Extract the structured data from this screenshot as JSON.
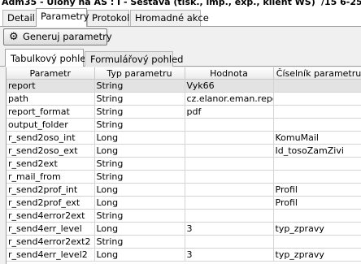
{
  "window": {
    "title": "Adm35 - Úlohy na AS : I - Sestava (tisk., imp., exp., klient WS)",
    "title_right": "/15 6-25"
  },
  "main_tabs": [
    {
      "label": "Detail"
    },
    {
      "label": "Parametry"
    },
    {
      "label": "Protokol"
    },
    {
      "label": "Hromadné akce"
    }
  ],
  "toolbar": {
    "generate_label": "Generuj parametry",
    "generate_icon": "gear-icon"
  },
  "sub_tabs": [
    {
      "label": "Tabulkový pohled"
    },
    {
      "label": "Formulářový pohled"
    }
  ],
  "table": {
    "columns": [
      "Parametr",
      "Typ parametru",
      "Hodnota",
      "Číselník parametru"
    ],
    "rows": [
      [
        "report",
        "String",
        "Vyk66",
        ""
      ],
      [
        "path",
        "String",
        "cz.elanor.eman.repo...",
        ""
      ],
      [
        "report_format",
        "String",
        "pdf",
        ""
      ],
      [
        "output_folder",
        "String",
        "",
        ""
      ],
      [
        "r_send2oso_int",
        "Long",
        "",
        "KomuMail"
      ],
      [
        "r_send2oso_ext",
        "Long",
        "",
        "Id_tosoZamZivi"
      ],
      [
        "r_send2ext",
        "String",
        "",
        ""
      ],
      [
        "r_mail_from",
        "String",
        "",
        ""
      ],
      [
        "r_send2prof_int",
        "Long",
        "",
        "Profil"
      ],
      [
        "r_send2prof_ext",
        "Long",
        "",
        "Profil"
      ],
      [
        "r_send4error2ext",
        "String",
        "",
        ""
      ],
      [
        "r_send4err_level",
        "Long",
        "3",
        "typ_zpravy"
      ],
      [
        "r_send4error2ext2",
        "String",
        "",
        ""
      ],
      [
        "r_send4err_level2",
        "Long",
        "3",
        "typ_zpravy"
      ]
    ]
  }
}
